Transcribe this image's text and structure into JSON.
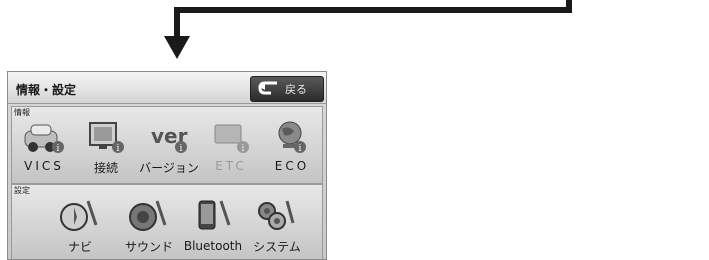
{
  "window": {
    "title": "情報・設定",
    "back_label": "戻る"
  },
  "info_section": {
    "label": "情報",
    "items": [
      {
        "label": "VICS",
        "icon": "car-info-icon",
        "enabled": true
      },
      {
        "label": "接続",
        "icon": "monitor-info-icon",
        "enabled": true
      },
      {
        "label": "バージョン",
        "icon": "ver-info-icon",
        "enabled": true
      },
      {
        "label": "ETC",
        "icon": "etc-card-info-icon",
        "enabled": false
      },
      {
        "label": "ECO",
        "icon": "globe-info-icon",
        "enabled": true
      }
    ]
  },
  "settings_section": {
    "label": "設定",
    "items": [
      {
        "label": "ナビ",
        "icon": "compass-settings-icon"
      },
      {
        "label": "サウンド",
        "icon": "speaker-settings-icon"
      },
      {
        "label": "Bluetooth",
        "icon": "phone-settings-icon"
      },
      {
        "label": "システム",
        "icon": "gears-settings-icon"
      }
    ]
  },
  "colors": {
    "info_badge": "#666666",
    "arrow": "#1a1a1a"
  }
}
